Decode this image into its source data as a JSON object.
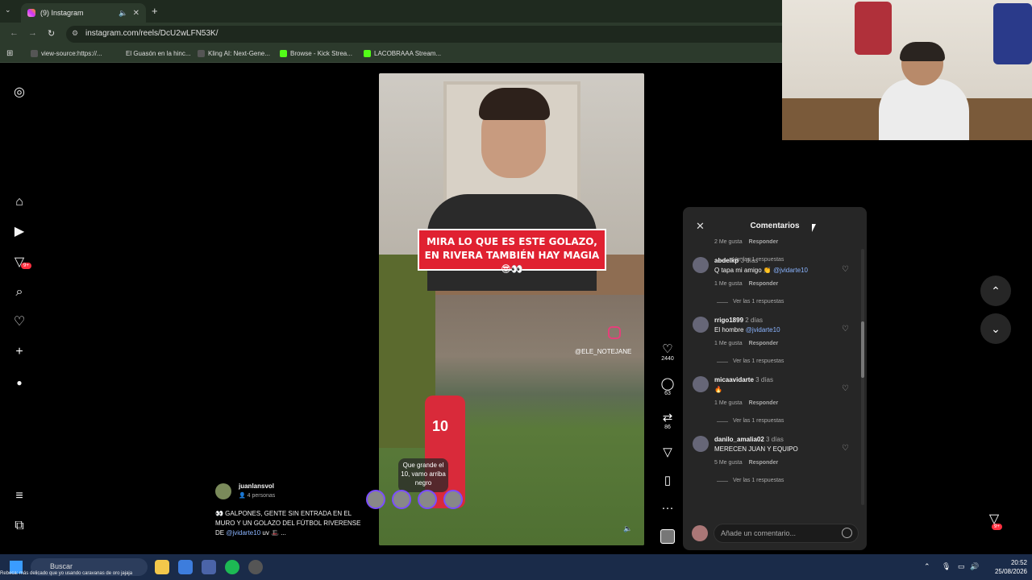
{
  "browser": {
    "tab_title": "(9) Instagram",
    "new_tab": "+",
    "url": "instagram.com/reels/DcU2wLFN53K/",
    "bookmarks": [
      "view-source:https://...",
      "El Guasón en la hinc...",
      "Kling AI: Next-Gene...",
      "Browse - Kick Strea...",
      "LACOBRAAA Stream..."
    ]
  },
  "reel": {
    "banner_text": "MIRA LO QUE ES ESTE GOLAZO, EN RIVERA TAMBIÉN HAY MAGIA 😎👀",
    "watermark": "@ELE_NOTEJANE",
    "jersey_number": "10",
    "bubble_text": "Que grande el 10, vamo arriba negro"
  },
  "caption": {
    "username": "juanlansvol",
    "people": "4 personas",
    "text_prefix": "👀 GALPONES, GENTE SIN ENTRADA EN EL MURO Y UN GOLAZO DEL FÚTBOL RIVERENSE DE ",
    "mention": "@jvidarte10",
    "text_suffix": " uv 🎩 ..."
  },
  "actions": {
    "likes": "2440",
    "comments": "63",
    "reposts": "86"
  },
  "comments_panel": {
    "title": "Comentarios",
    "top_partial": {
      "likes": "2 Me gusta",
      "reply": "Responder",
      "view_replies": "Ver las 1 respuestas"
    },
    "items": [
      {
        "user": "abdelkp",
        "age": "3 días",
        "text": "Q tapa mi amigo 👏",
        "mention": "@jvidarte10",
        "likes": "1 Me gusta",
        "reply": "Responder",
        "view_replies": "Ver las 1 respuestas"
      },
      {
        "user": "rrigo1899",
        "age": "2 días",
        "text": "El hombre",
        "mention": "@jvidarte10",
        "likes": "1 Me gusta",
        "reply": "Responder",
        "view_replies": "Ver las 1 respuestas"
      },
      {
        "user": "micaavidarte",
        "age": "3 días",
        "text": "🔥",
        "mention": "",
        "likes": "1 Me gusta",
        "reply": "Responder",
        "view_replies": "Ver las 1 respuestas"
      },
      {
        "user": "danilo_amalia02",
        "age": "3 días",
        "text": "MERECEN JUAN Y EQUIPO",
        "mention": "",
        "likes": "5 Me gusta",
        "reply": "Responder",
        "view_replies": "Ver las 1 respuestas"
      }
    ],
    "add_placeholder": "Añade un comentario..."
  },
  "sidebar_badge": "9+",
  "dm_badge": "9+",
  "taskbar": {
    "search": "Buscar",
    "time": "20:52",
    "date": "25/08/2026",
    "ticker": "Rebeca: más delicado que yo usando caravanas de oro jajaja"
  }
}
